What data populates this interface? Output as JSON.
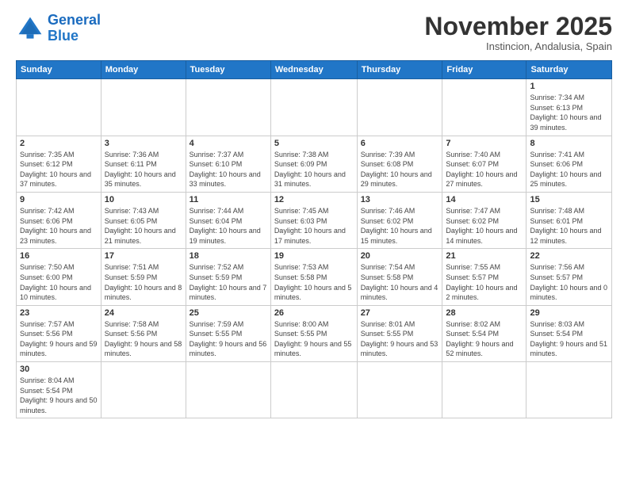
{
  "logo": {
    "line1": "General",
    "line2": "Blue"
  },
  "title": "November 2025",
  "subtitle": "Instincion, Andalusia, Spain",
  "weekdays": [
    "Sunday",
    "Monday",
    "Tuesday",
    "Wednesday",
    "Thursday",
    "Friday",
    "Saturday"
  ],
  "days": {
    "1": {
      "sunrise": "7:34 AM",
      "sunset": "6:13 PM",
      "daylight": "10 hours and 39 minutes."
    },
    "2": {
      "sunrise": "7:35 AM",
      "sunset": "6:12 PM",
      "daylight": "10 hours and 37 minutes."
    },
    "3": {
      "sunrise": "7:36 AM",
      "sunset": "6:11 PM",
      "daylight": "10 hours and 35 minutes."
    },
    "4": {
      "sunrise": "7:37 AM",
      "sunset": "6:10 PM",
      "daylight": "10 hours and 33 minutes."
    },
    "5": {
      "sunrise": "7:38 AM",
      "sunset": "6:09 PM",
      "daylight": "10 hours and 31 minutes."
    },
    "6": {
      "sunrise": "7:39 AM",
      "sunset": "6:08 PM",
      "daylight": "10 hours and 29 minutes."
    },
    "7": {
      "sunrise": "7:40 AM",
      "sunset": "6:07 PM",
      "daylight": "10 hours and 27 minutes."
    },
    "8": {
      "sunrise": "7:41 AM",
      "sunset": "6:06 PM",
      "daylight": "10 hours and 25 minutes."
    },
    "9": {
      "sunrise": "7:42 AM",
      "sunset": "6:06 PM",
      "daylight": "10 hours and 23 minutes."
    },
    "10": {
      "sunrise": "7:43 AM",
      "sunset": "6:05 PM",
      "daylight": "10 hours and 21 minutes."
    },
    "11": {
      "sunrise": "7:44 AM",
      "sunset": "6:04 PM",
      "daylight": "10 hours and 19 minutes."
    },
    "12": {
      "sunrise": "7:45 AM",
      "sunset": "6:03 PM",
      "daylight": "10 hours and 17 minutes."
    },
    "13": {
      "sunrise": "7:46 AM",
      "sunset": "6:02 PM",
      "daylight": "10 hours and 15 minutes."
    },
    "14": {
      "sunrise": "7:47 AM",
      "sunset": "6:02 PM",
      "daylight": "10 hours and 14 minutes."
    },
    "15": {
      "sunrise": "7:48 AM",
      "sunset": "6:01 PM",
      "daylight": "10 hours and 12 minutes."
    },
    "16": {
      "sunrise": "7:50 AM",
      "sunset": "6:00 PM",
      "daylight": "10 hours and 10 minutes."
    },
    "17": {
      "sunrise": "7:51 AM",
      "sunset": "5:59 PM",
      "daylight": "10 hours and 8 minutes."
    },
    "18": {
      "sunrise": "7:52 AM",
      "sunset": "5:59 PM",
      "daylight": "10 hours and 7 minutes."
    },
    "19": {
      "sunrise": "7:53 AM",
      "sunset": "5:58 PM",
      "daylight": "10 hours and 5 minutes."
    },
    "20": {
      "sunrise": "7:54 AM",
      "sunset": "5:58 PM",
      "daylight": "10 hours and 4 minutes."
    },
    "21": {
      "sunrise": "7:55 AM",
      "sunset": "5:57 PM",
      "daylight": "10 hours and 2 minutes."
    },
    "22": {
      "sunrise": "7:56 AM",
      "sunset": "5:57 PM",
      "daylight": "10 hours and 0 minutes."
    },
    "23": {
      "sunrise": "7:57 AM",
      "sunset": "5:56 PM",
      "daylight": "9 hours and 59 minutes."
    },
    "24": {
      "sunrise": "7:58 AM",
      "sunset": "5:56 PM",
      "daylight": "9 hours and 58 minutes."
    },
    "25": {
      "sunrise": "7:59 AM",
      "sunset": "5:55 PM",
      "daylight": "9 hours and 56 minutes."
    },
    "26": {
      "sunrise": "8:00 AM",
      "sunset": "5:55 PM",
      "daylight": "9 hours and 55 minutes."
    },
    "27": {
      "sunrise": "8:01 AM",
      "sunset": "5:55 PM",
      "daylight": "9 hours and 53 minutes."
    },
    "28": {
      "sunrise": "8:02 AM",
      "sunset": "5:54 PM",
      "daylight": "9 hours and 52 minutes."
    },
    "29": {
      "sunrise": "8:03 AM",
      "sunset": "5:54 PM",
      "daylight": "9 hours and 51 minutes."
    },
    "30": {
      "sunrise": "8:04 AM",
      "sunset": "5:54 PM",
      "daylight": "9 hours and 50 minutes."
    }
  }
}
